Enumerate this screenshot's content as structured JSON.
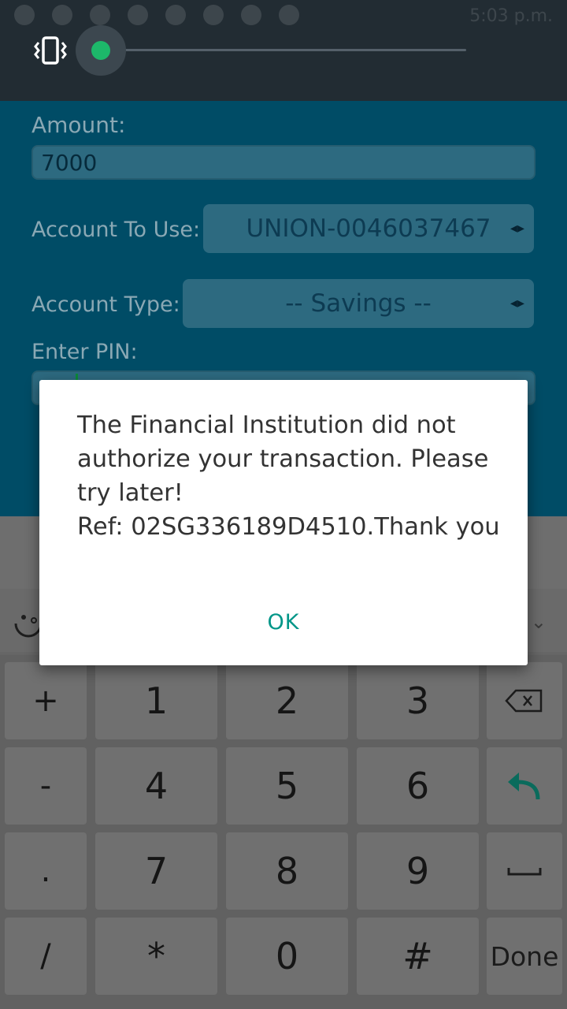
{
  "status_bar": {
    "time": "5:03 p.m."
  },
  "form": {
    "amount_label": "Amount:",
    "amount_value": "7000",
    "account_label": "Account To Use:",
    "account_value": "UNION-0046037467",
    "type_label": "Account Type:",
    "type_value": "-- Savings --",
    "pin_label": "Enter PIN:",
    "spinner_icon": "◂▸"
  },
  "volume_slider": {
    "mode_icon": "vibrate-icon",
    "level": 0.0,
    "accent": "#1db86a"
  },
  "dialog": {
    "message": "The Financial Institution did not authorize your transaction. Please try later!\nRef: 02SG336189D4510.Thank you",
    "ok_label": "OK",
    "accent": "#009688"
  },
  "keyboard": {
    "rows": [
      [
        "+",
        "1",
        "2",
        "3",
        "⌫"
      ],
      [
        "-",
        "4",
        "5",
        "6",
        "↩"
      ],
      [
        ".",
        "7",
        "8",
        "9",
        "␣"
      ],
      [
        "/",
        "*",
        "0",
        "#",
        "Done"
      ]
    ]
  }
}
